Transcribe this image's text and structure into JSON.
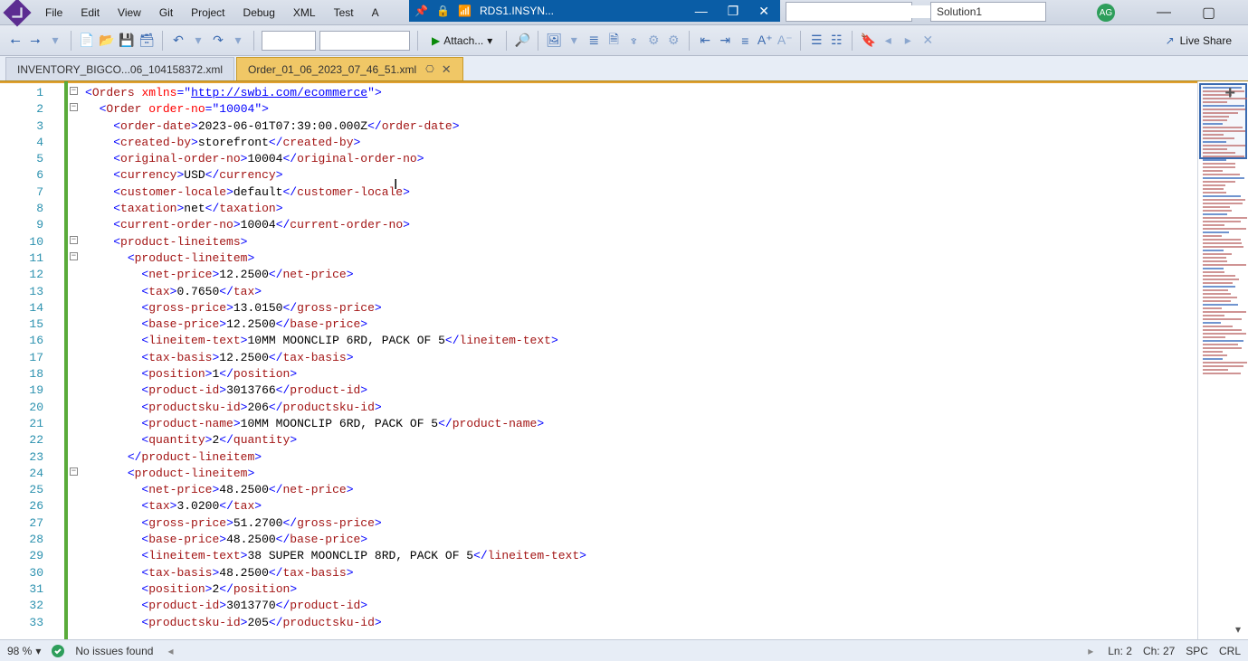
{
  "menu": {
    "items": [
      "File",
      "Edit",
      "View",
      "Git",
      "Project",
      "Debug",
      "XML",
      "Test",
      "A"
    ]
  },
  "titlecenter": {
    "label": "RDS1.INSYN..."
  },
  "solution": {
    "name": "Solution1"
  },
  "avatar": {
    "initials": "AG"
  },
  "toolbar": {
    "attach": "Attach...",
    "liveshare": "Live Share"
  },
  "tabs": [
    {
      "label": "INVENTORY_BIGCO...06_104158372.xml",
      "active": false
    },
    {
      "label": "Order_01_06_2023_07_46_51.xml",
      "active": true
    }
  ],
  "editor": {
    "url": "http://swbi.com/ecommerce",
    "lines": [
      {
        "n": 1,
        "indent": 0,
        "fold": "-",
        "seg": [
          {
            "t": "brk",
            "v": "<"
          },
          {
            "t": "tag",
            "v": "Orders"
          },
          {
            "t": "txt",
            "v": " "
          },
          {
            "t": "attr",
            "v": "xmlns"
          },
          {
            "t": "brk",
            "v": "="
          },
          {
            "t": "brk",
            "v": "\""
          },
          {
            "t": "url",
            "v": "http://swbi.com/ecommerce"
          },
          {
            "t": "brk",
            "v": "\""
          },
          {
            "t": "brk",
            "v": ">"
          }
        ]
      },
      {
        "n": 2,
        "indent": 1,
        "fold": "-",
        "seg": [
          {
            "t": "brk",
            "v": "<"
          },
          {
            "t": "tag",
            "v": "Order"
          },
          {
            "t": "txt",
            "v": " "
          },
          {
            "t": "attr",
            "v": "order-no"
          },
          {
            "t": "brk",
            "v": "="
          },
          {
            "t": "brk",
            "v": "\""
          },
          {
            "t": "val",
            "v": "10004"
          },
          {
            "t": "brk",
            "v": "\">"
          }
        ]
      },
      {
        "n": 3,
        "indent": 2,
        "seg": [
          {
            "t": "brk",
            "v": "<"
          },
          {
            "t": "tag",
            "v": "order-date"
          },
          {
            "t": "brk",
            "v": ">"
          },
          {
            "t": "txt",
            "v": "2023-06-01T07:39:00.000Z"
          },
          {
            "t": "brk",
            "v": "</"
          },
          {
            "t": "tag",
            "v": "order-date"
          },
          {
            "t": "brk",
            "v": ">"
          }
        ]
      },
      {
        "n": 4,
        "indent": 2,
        "seg": [
          {
            "t": "brk",
            "v": "<"
          },
          {
            "t": "tag",
            "v": "created-by"
          },
          {
            "t": "brk",
            "v": ">"
          },
          {
            "t": "txt",
            "v": "storefront"
          },
          {
            "t": "brk",
            "v": "</"
          },
          {
            "t": "tag",
            "v": "created-by"
          },
          {
            "t": "brk",
            "v": ">"
          }
        ]
      },
      {
        "n": 5,
        "indent": 2,
        "seg": [
          {
            "t": "brk",
            "v": "<"
          },
          {
            "t": "tag",
            "v": "original-order-no"
          },
          {
            "t": "brk",
            "v": ">"
          },
          {
            "t": "txt",
            "v": "10004"
          },
          {
            "t": "brk",
            "v": "</"
          },
          {
            "t": "tag",
            "v": "original-order-no"
          },
          {
            "t": "brk",
            "v": ">"
          }
        ]
      },
      {
        "n": 6,
        "indent": 2,
        "seg": [
          {
            "t": "brk",
            "v": "<"
          },
          {
            "t": "tag",
            "v": "currency"
          },
          {
            "t": "brk",
            "v": ">"
          },
          {
            "t": "txt",
            "v": "USD"
          },
          {
            "t": "brk",
            "v": "</"
          },
          {
            "t": "tag",
            "v": "currency"
          },
          {
            "t": "brk",
            "v": ">"
          }
        ]
      },
      {
        "n": 7,
        "indent": 2,
        "seg": [
          {
            "t": "brk",
            "v": "<"
          },
          {
            "t": "tag",
            "v": "customer-locale"
          },
          {
            "t": "brk",
            "v": ">"
          },
          {
            "t": "txt",
            "v": "default"
          },
          {
            "t": "brk",
            "v": "</"
          },
          {
            "t": "tag",
            "v": "customer-locale"
          },
          {
            "t": "brk",
            "v": ">"
          }
        ]
      },
      {
        "n": 8,
        "indent": 2,
        "seg": [
          {
            "t": "brk",
            "v": "<"
          },
          {
            "t": "tag",
            "v": "taxation"
          },
          {
            "t": "brk",
            "v": ">"
          },
          {
            "t": "txt",
            "v": "net"
          },
          {
            "t": "brk",
            "v": "</"
          },
          {
            "t": "tag",
            "v": "taxation"
          },
          {
            "t": "brk",
            "v": ">"
          }
        ]
      },
      {
        "n": 9,
        "indent": 2,
        "seg": [
          {
            "t": "brk",
            "v": "<"
          },
          {
            "t": "tag",
            "v": "current-order-no"
          },
          {
            "t": "brk",
            "v": ">"
          },
          {
            "t": "txt",
            "v": "10004"
          },
          {
            "t": "brk",
            "v": "</"
          },
          {
            "t": "tag",
            "v": "current-order-no"
          },
          {
            "t": "brk",
            "v": ">"
          }
        ]
      },
      {
        "n": 10,
        "indent": 2,
        "fold": "-",
        "seg": [
          {
            "t": "brk",
            "v": "<"
          },
          {
            "t": "tag",
            "v": "product-lineitems"
          },
          {
            "t": "brk",
            "v": ">"
          }
        ]
      },
      {
        "n": 11,
        "indent": 3,
        "fold": "-",
        "seg": [
          {
            "t": "brk",
            "v": "<"
          },
          {
            "t": "tag",
            "v": "product-lineitem"
          },
          {
            "t": "brk",
            "v": ">"
          }
        ]
      },
      {
        "n": 12,
        "indent": 4,
        "seg": [
          {
            "t": "brk",
            "v": "<"
          },
          {
            "t": "tag",
            "v": "net-price"
          },
          {
            "t": "brk",
            "v": ">"
          },
          {
            "t": "txt",
            "v": "12.2500"
          },
          {
            "t": "brk",
            "v": "</"
          },
          {
            "t": "tag",
            "v": "net-price"
          },
          {
            "t": "brk",
            "v": ">"
          }
        ]
      },
      {
        "n": 13,
        "indent": 4,
        "seg": [
          {
            "t": "brk",
            "v": "<"
          },
          {
            "t": "tag",
            "v": "tax"
          },
          {
            "t": "brk",
            "v": ">"
          },
          {
            "t": "txt",
            "v": "0.7650"
          },
          {
            "t": "brk",
            "v": "</"
          },
          {
            "t": "tag",
            "v": "tax"
          },
          {
            "t": "brk",
            "v": ">"
          }
        ]
      },
      {
        "n": 14,
        "indent": 4,
        "seg": [
          {
            "t": "brk",
            "v": "<"
          },
          {
            "t": "tag",
            "v": "gross-price"
          },
          {
            "t": "brk",
            "v": ">"
          },
          {
            "t": "txt",
            "v": "13.0150"
          },
          {
            "t": "brk",
            "v": "</"
          },
          {
            "t": "tag",
            "v": "gross-price"
          },
          {
            "t": "brk",
            "v": ">"
          }
        ]
      },
      {
        "n": 15,
        "indent": 4,
        "seg": [
          {
            "t": "brk",
            "v": "<"
          },
          {
            "t": "tag",
            "v": "base-price"
          },
          {
            "t": "brk",
            "v": ">"
          },
          {
            "t": "txt",
            "v": "12.2500"
          },
          {
            "t": "brk",
            "v": "</"
          },
          {
            "t": "tag",
            "v": "base-price"
          },
          {
            "t": "brk",
            "v": ">"
          }
        ]
      },
      {
        "n": 16,
        "indent": 4,
        "seg": [
          {
            "t": "brk",
            "v": "<"
          },
          {
            "t": "tag",
            "v": "lineitem-text"
          },
          {
            "t": "brk",
            "v": ">"
          },
          {
            "t": "txt",
            "v": "10MM MOONCLIP 6RD, PACK OF 5"
          },
          {
            "t": "brk",
            "v": "</"
          },
          {
            "t": "tag",
            "v": "lineitem-text"
          },
          {
            "t": "brk",
            "v": ">"
          }
        ]
      },
      {
        "n": 17,
        "indent": 4,
        "seg": [
          {
            "t": "brk",
            "v": "<"
          },
          {
            "t": "tag",
            "v": "tax-basis"
          },
          {
            "t": "brk",
            "v": ">"
          },
          {
            "t": "txt",
            "v": "12.2500"
          },
          {
            "t": "brk",
            "v": "</"
          },
          {
            "t": "tag",
            "v": "tax-basis"
          },
          {
            "t": "brk",
            "v": ">"
          }
        ]
      },
      {
        "n": 18,
        "indent": 4,
        "seg": [
          {
            "t": "brk",
            "v": "<"
          },
          {
            "t": "tag",
            "v": "position"
          },
          {
            "t": "brk",
            "v": ">"
          },
          {
            "t": "txt",
            "v": "1"
          },
          {
            "t": "brk",
            "v": "</"
          },
          {
            "t": "tag",
            "v": "position"
          },
          {
            "t": "brk",
            "v": ">"
          }
        ]
      },
      {
        "n": 19,
        "indent": 4,
        "seg": [
          {
            "t": "brk",
            "v": "<"
          },
          {
            "t": "tag",
            "v": "product-id"
          },
          {
            "t": "brk",
            "v": ">"
          },
          {
            "t": "txt",
            "v": "3013766"
          },
          {
            "t": "brk",
            "v": "</"
          },
          {
            "t": "tag",
            "v": "product-id"
          },
          {
            "t": "brk",
            "v": ">"
          }
        ]
      },
      {
        "n": 20,
        "indent": 4,
        "seg": [
          {
            "t": "brk",
            "v": "<"
          },
          {
            "t": "tag",
            "v": "productsku-id"
          },
          {
            "t": "brk",
            "v": ">"
          },
          {
            "t": "txt",
            "v": "206"
          },
          {
            "t": "brk",
            "v": "</"
          },
          {
            "t": "tag",
            "v": "productsku-id"
          },
          {
            "t": "brk",
            "v": ">"
          }
        ]
      },
      {
        "n": 21,
        "indent": 4,
        "seg": [
          {
            "t": "brk",
            "v": "<"
          },
          {
            "t": "tag",
            "v": "product-name"
          },
          {
            "t": "brk",
            "v": ">"
          },
          {
            "t": "txt",
            "v": "10MM MOONCLIP 6RD, PACK OF 5"
          },
          {
            "t": "brk",
            "v": "</"
          },
          {
            "t": "tag",
            "v": "product-name"
          },
          {
            "t": "brk",
            "v": ">"
          }
        ]
      },
      {
        "n": 22,
        "indent": 4,
        "seg": [
          {
            "t": "brk",
            "v": "<"
          },
          {
            "t": "tag",
            "v": "quantity"
          },
          {
            "t": "brk",
            "v": ">"
          },
          {
            "t": "txt",
            "v": "2"
          },
          {
            "t": "brk",
            "v": "</"
          },
          {
            "t": "tag",
            "v": "quantity"
          },
          {
            "t": "brk",
            "v": ">"
          }
        ]
      },
      {
        "n": 23,
        "indent": 3,
        "seg": [
          {
            "t": "brk",
            "v": "</"
          },
          {
            "t": "tag",
            "v": "product-lineitem"
          },
          {
            "t": "brk",
            "v": ">"
          }
        ]
      },
      {
        "n": 24,
        "indent": 3,
        "fold": "-",
        "seg": [
          {
            "t": "brk",
            "v": "<"
          },
          {
            "t": "tag",
            "v": "product-lineitem"
          },
          {
            "t": "brk",
            "v": ">"
          }
        ]
      },
      {
        "n": 25,
        "indent": 4,
        "seg": [
          {
            "t": "brk",
            "v": "<"
          },
          {
            "t": "tag",
            "v": "net-price"
          },
          {
            "t": "brk",
            "v": ">"
          },
          {
            "t": "txt",
            "v": "48.2500"
          },
          {
            "t": "brk",
            "v": "</"
          },
          {
            "t": "tag",
            "v": "net-price"
          },
          {
            "t": "brk",
            "v": ">"
          }
        ]
      },
      {
        "n": 26,
        "indent": 4,
        "seg": [
          {
            "t": "brk",
            "v": "<"
          },
          {
            "t": "tag",
            "v": "tax"
          },
          {
            "t": "brk",
            "v": ">"
          },
          {
            "t": "txt",
            "v": "3.0200"
          },
          {
            "t": "brk",
            "v": "</"
          },
          {
            "t": "tag",
            "v": "tax"
          },
          {
            "t": "brk",
            "v": ">"
          }
        ]
      },
      {
        "n": 27,
        "indent": 4,
        "seg": [
          {
            "t": "brk",
            "v": "<"
          },
          {
            "t": "tag",
            "v": "gross-price"
          },
          {
            "t": "brk",
            "v": ">"
          },
          {
            "t": "txt",
            "v": "51.2700"
          },
          {
            "t": "brk",
            "v": "</"
          },
          {
            "t": "tag",
            "v": "gross-price"
          },
          {
            "t": "brk",
            "v": ">"
          }
        ]
      },
      {
        "n": 28,
        "indent": 4,
        "seg": [
          {
            "t": "brk",
            "v": "<"
          },
          {
            "t": "tag",
            "v": "base-price"
          },
          {
            "t": "brk",
            "v": ">"
          },
          {
            "t": "txt",
            "v": "48.2500"
          },
          {
            "t": "brk",
            "v": "</"
          },
          {
            "t": "tag",
            "v": "base-price"
          },
          {
            "t": "brk",
            "v": ">"
          }
        ]
      },
      {
        "n": 29,
        "indent": 4,
        "seg": [
          {
            "t": "brk",
            "v": "<"
          },
          {
            "t": "tag",
            "v": "lineitem-text"
          },
          {
            "t": "brk",
            "v": ">"
          },
          {
            "t": "txt",
            "v": "38 SUPER MOONCLIP 8RD, PACK OF 5"
          },
          {
            "t": "brk",
            "v": "</"
          },
          {
            "t": "tag",
            "v": "lineitem-text"
          },
          {
            "t": "brk",
            "v": ">"
          }
        ]
      },
      {
        "n": 30,
        "indent": 4,
        "seg": [
          {
            "t": "brk",
            "v": "<"
          },
          {
            "t": "tag",
            "v": "tax-basis"
          },
          {
            "t": "brk",
            "v": ">"
          },
          {
            "t": "txt",
            "v": "48.2500"
          },
          {
            "t": "brk",
            "v": "</"
          },
          {
            "t": "tag",
            "v": "tax-basis"
          },
          {
            "t": "brk",
            "v": ">"
          }
        ]
      },
      {
        "n": 31,
        "indent": 4,
        "seg": [
          {
            "t": "brk",
            "v": "<"
          },
          {
            "t": "tag",
            "v": "position"
          },
          {
            "t": "brk",
            "v": ">"
          },
          {
            "t": "txt",
            "v": "2"
          },
          {
            "t": "brk",
            "v": "</"
          },
          {
            "t": "tag",
            "v": "position"
          },
          {
            "t": "brk",
            "v": ">"
          }
        ]
      },
      {
        "n": 32,
        "indent": 4,
        "seg": [
          {
            "t": "brk",
            "v": "<"
          },
          {
            "t": "tag",
            "v": "product-id"
          },
          {
            "t": "brk",
            "v": ">"
          },
          {
            "t": "txt",
            "v": "3013770"
          },
          {
            "t": "brk",
            "v": "</"
          },
          {
            "t": "tag",
            "v": "product-id"
          },
          {
            "t": "brk",
            "v": ">"
          }
        ]
      },
      {
        "n": 33,
        "indent": 4,
        "seg": [
          {
            "t": "brk",
            "v": "<"
          },
          {
            "t": "tag",
            "v": "productsku-id"
          },
          {
            "t": "brk",
            "v": ">"
          },
          {
            "t": "txt",
            "v": "205"
          },
          {
            "t": "brk",
            "v": "</"
          },
          {
            "t": "tag",
            "v": "productsku-id"
          },
          {
            "t": "brk",
            "v": ">"
          }
        ]
      }
    ]
  },
  "status": {
    "zoom": "98 %",
    "issues": "No issues found",
    "ln": "Ln: 2",
    "ch": "Ch: 27",
    "spc": "SPC",
    "crlf": "CRL"
  }
}
